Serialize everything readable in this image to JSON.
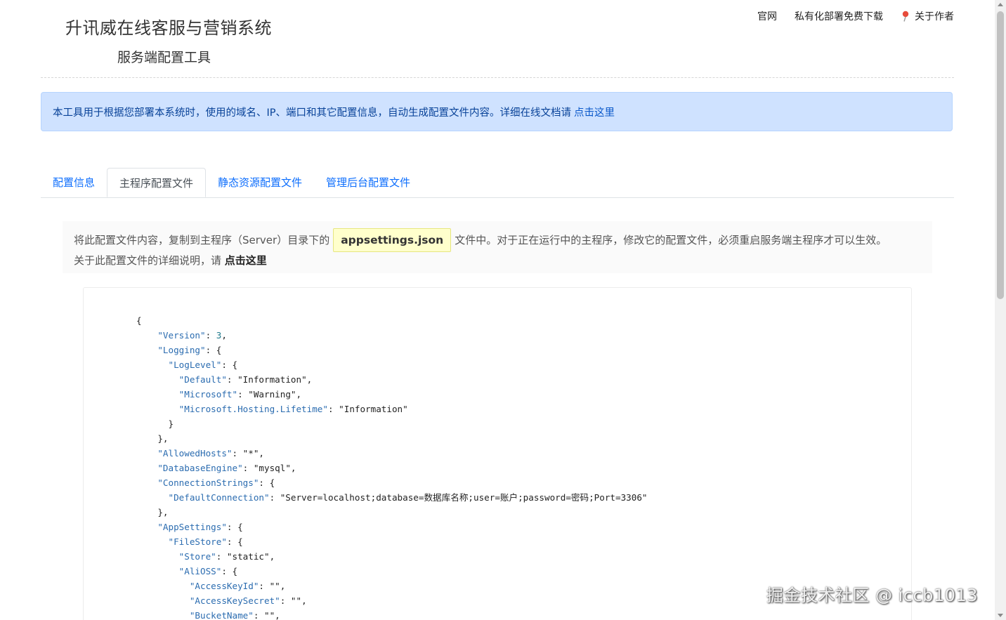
{
  "header": {
    "title": "升讯威在线客服与营销系统",
    "subtitle": "服务端配置工具",
    "nav": {
      "official_site": "官网",
      "private_deploy": "私有化部署免费下载",
      "about_author": "关于作者",
      "pin_color": "#e74c3c"
    }
  },
  "alert": {
    "text": "本工具用于根据您部署本系统时，使用的域名、IP、端口和其它配置信息，自动生成配置文件内容。详细在线文档请",
    "link": "点击这里"
  },
  "tabs": [
    {
      "label": "配置信息",
      "active": false
    },
    {
      "label": "主程序配置文件",
      "active": true
    },
    {
      "label": "静态资源配置文件",
      "active": false
    },
    {
      "label": "管理后台配置文件",
      "active": false
    }
  ],
  "note": {
    "prefix": "将此配置文件内容，复制到主程序（Server）目录下的",
    "filename": "appsettings.json",
    "suffix": "文件中。对于正在运行中的主程序，修改它的配置文件，必须重启服务端主程序才可以生效。",
    "line2_prefix": "关于此配置文件的详细说明，请",
    "line2_link": "点击这里"
  },
  "code": {
    "lines": [
      "{",
      "    \"Version\": 3,",
      "    \"Logging\": {",
      "      \"LogLevel\": {",
      "        \"Default\": \"Information\",",
      "        \"Microsoft\": \"Warning\",",
      "        \"Microsoft.Hosting.Lifetime\": \"Information\"",
      "      }",
      "    },",
      "    \"AllowedHosts\": \"*\",",
      "    \"DatabaseEngine\": \"mysql\",",
      "    \"ConnectionStrings\": {",
      "      \"DefaultConnection\": \"Server=localhost;database=数据库名称;user=账户;password=密码;Port=3306\"",
      "    },",
      "    \"AppSettings\": {",
      "      \"FileStore\": {",
      "        \"Store\": \"static\",",
      "        \"AliOSS\": {",
      "          \"AccessKeyId\": \"\",",
      "          \"AccessKeySecret\": \"\",",
      "          \"BucketName\": \"\","
    ]
  },
  "watermark": "掘金技术社区 @ iccb1013"
}
